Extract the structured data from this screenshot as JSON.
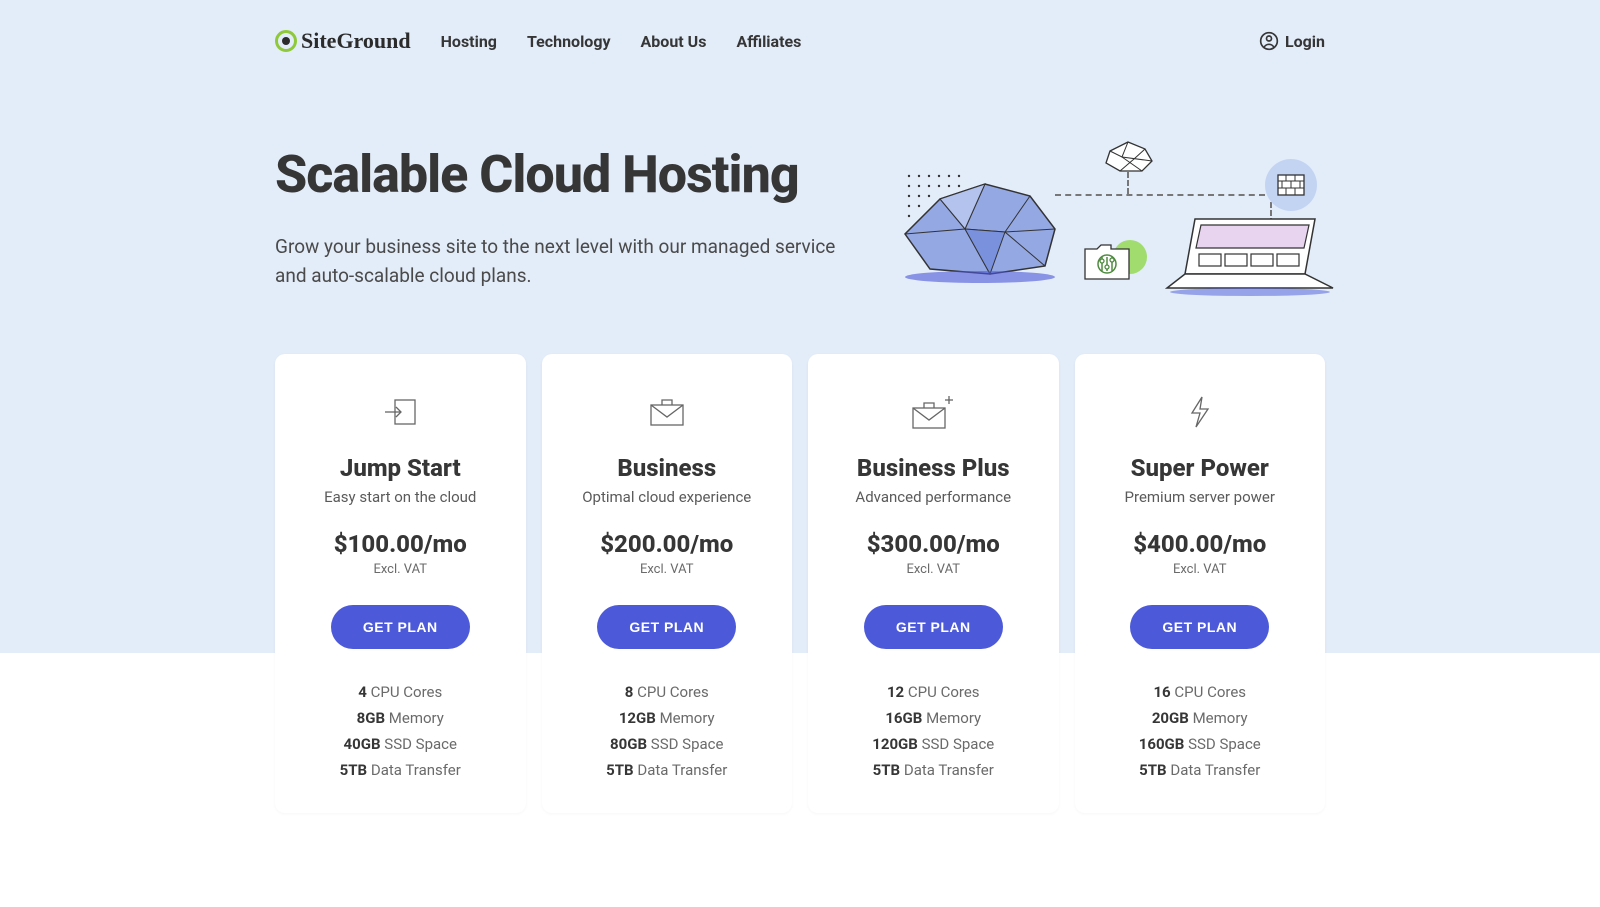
{
  "header": {
    "logo_text": "SiteGround",
    "nav": [
      "Hosting",
      "Technology",
      "About Us",
      "Affiliates"
    ],
    "login_label": "Login"
  },
  "hero": {
    "title": "Scalable Cloud Hosting",
    "subtitle": "Grow your business site to the next level with our managed service and auto-scalable cloud plans."
  },
  "plans": [
    {
      "name": "Jump Start",
      "tagline": "Easy start on the cloud",
      "price": "$100.00/mo",
      "vat": "Excl. VAT",
      "cta": "GET PLAN",
      "specs": [
        {
          "value": "4",
          "label": "CPU Cores"
        },
        {
          "value": "8GB",
          "label": "Memory"
        },
        {
          "value": "40GB",
          "label": "SSD Space"
        },
        {
          "value": "5TB",
          "label": "Data Transfer"
        }
      ]
    },
    {
      "name": "Business",
      "tagline": "Optimal cloud experience",
      "price": "$200.00/mo",
      "vat": "Excl. VAT",
      "cta": "GET PLAN",
      "specs": [
        {
          "value": "8",
          "label": "CPU Cores"
        },
        {
          "value": "12GB",
          "label": "Memory"
        },
        {
          "value": "80GB",
          "label": "SSD Space"
        },
        {
          "value": "5TB",
          "label": "Data Transfer"
        }
      ]
    },
    {
      "name": "Business Plus",
      "tagline": "Advanced performance",
      "price": "$300.00/mo",
      "vat": "Excl. VAT",
      "cta": "GET PLAN",
      "specs": [
        {
          "value": "12",
          "label": "CPU Cores"
        },
        {
          "value": "16GB",
          "label": "Memory"
        },
        {
          "value": "120GB",
          "label": "SSD Space"
        },
        {
          "value": "5TB",
          "label": "Data Transfer"
        }
      ]
    },
    {
      "name": "Super Power",
      "tagline": "Premium server power",
      "price": "$400.00/mo",
      "vat": "Excl. VAT",
      "cta": "GET PLAN",
      "specs": [
        {
          "value": "16",
          "label": "CPU Cores"
        },
        {
          "value": "20GB",
          "label": "Memory"
        },
        {
          "value": "160GB",
          "label": "SSD Space"
        },
        {
          "value": "5TB",
          "label": "Data Transfer"
        }
      ]
    }
  ]
}
